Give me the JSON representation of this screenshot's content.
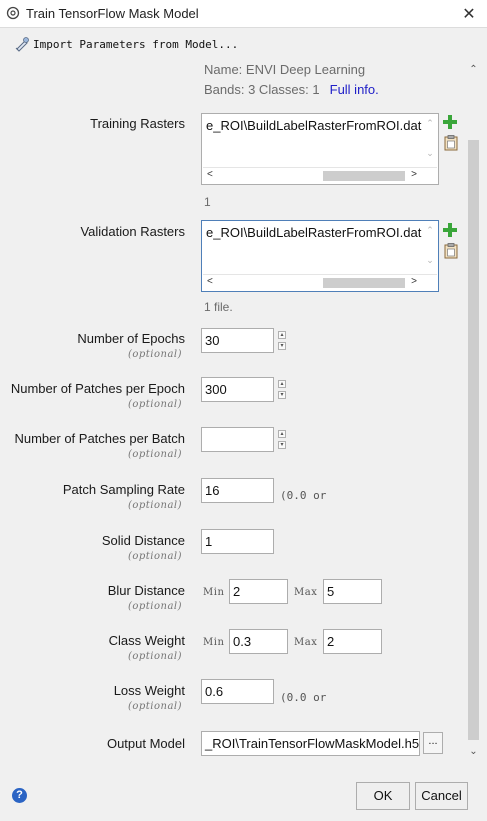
{
  "window": {
    "title": "Train TensorFlow Mask Model",
    "close_glyph": "✕"
  },
  "toolbar": {
    "import_label": "Import Parameters from Model..."
  },
  "model_info": {
    "name": "Name: ENVI Deep Learning",
    "bands_classes": "Bands: 3   Classes: 1",
    "full_info": "Full info."
  },
  "training_rasters": {
    "label": "Training Rasters",
    "entry": "e_ROI\\BuildLabelRasterFromROI.dat",
    "count_text": "1"
  },
  "validation_rasters": {
    "label": "Validation Rasters",
    "entry": "e_ROI\\BuildLabelRasterFromROI.dat",
    "count_text": "1 file."
  },
  "optional_text": "(optional)",
  "epochs": {
    "label": "Number of Epochs",
    "value": "30"
  },
  "patches_per_epoch": {
    "label": "Number of Patches per Epoch",
    "value": "300"
  },
  "patches_per_batch": {
    "label": "Number of Patches per Batch",
    "value": ""
  },
  "patch_sampling_rate": {
    "label": "Patch Sampling Rate",
    "value": "16",
    "hint": "(0.0 or"
  },
  "solid_distance": {
    "label": "Solid Distance",
    "value": "1"
  },
  "blur_distance": {
    "label": "Blur Distance",
    "min_label": "Min",
    "min_value": "2",
    "max_label": "Max",
    "max_value": "5"
  },
  "class_weight": {
    "label": "Class Weight",
    "min_label": "Min",
    "min_value": "0.3",
    "max_label": "Max",
    "max_value": "2"
  },
  "loss_weight": {
    "label": "Loss Weight",
    "value": "0.6",
    "hint": "(0.0 or"
  },
  "output_model": {
    "label": "Output Model",
    "value": "_ROI\\TrainTensorFlowMaskModel.h5",
    "browse_label": "..."
  },
  "footer": {
    "help_glyph": "?",
    "ok_label": "OK",
    "cancel_label": "Cancel"
  },
  "colors": {
    "add_icon": "#3aa63a",
    "link": "#2020c8",
    "help": "#2b64c4"
  }
}
